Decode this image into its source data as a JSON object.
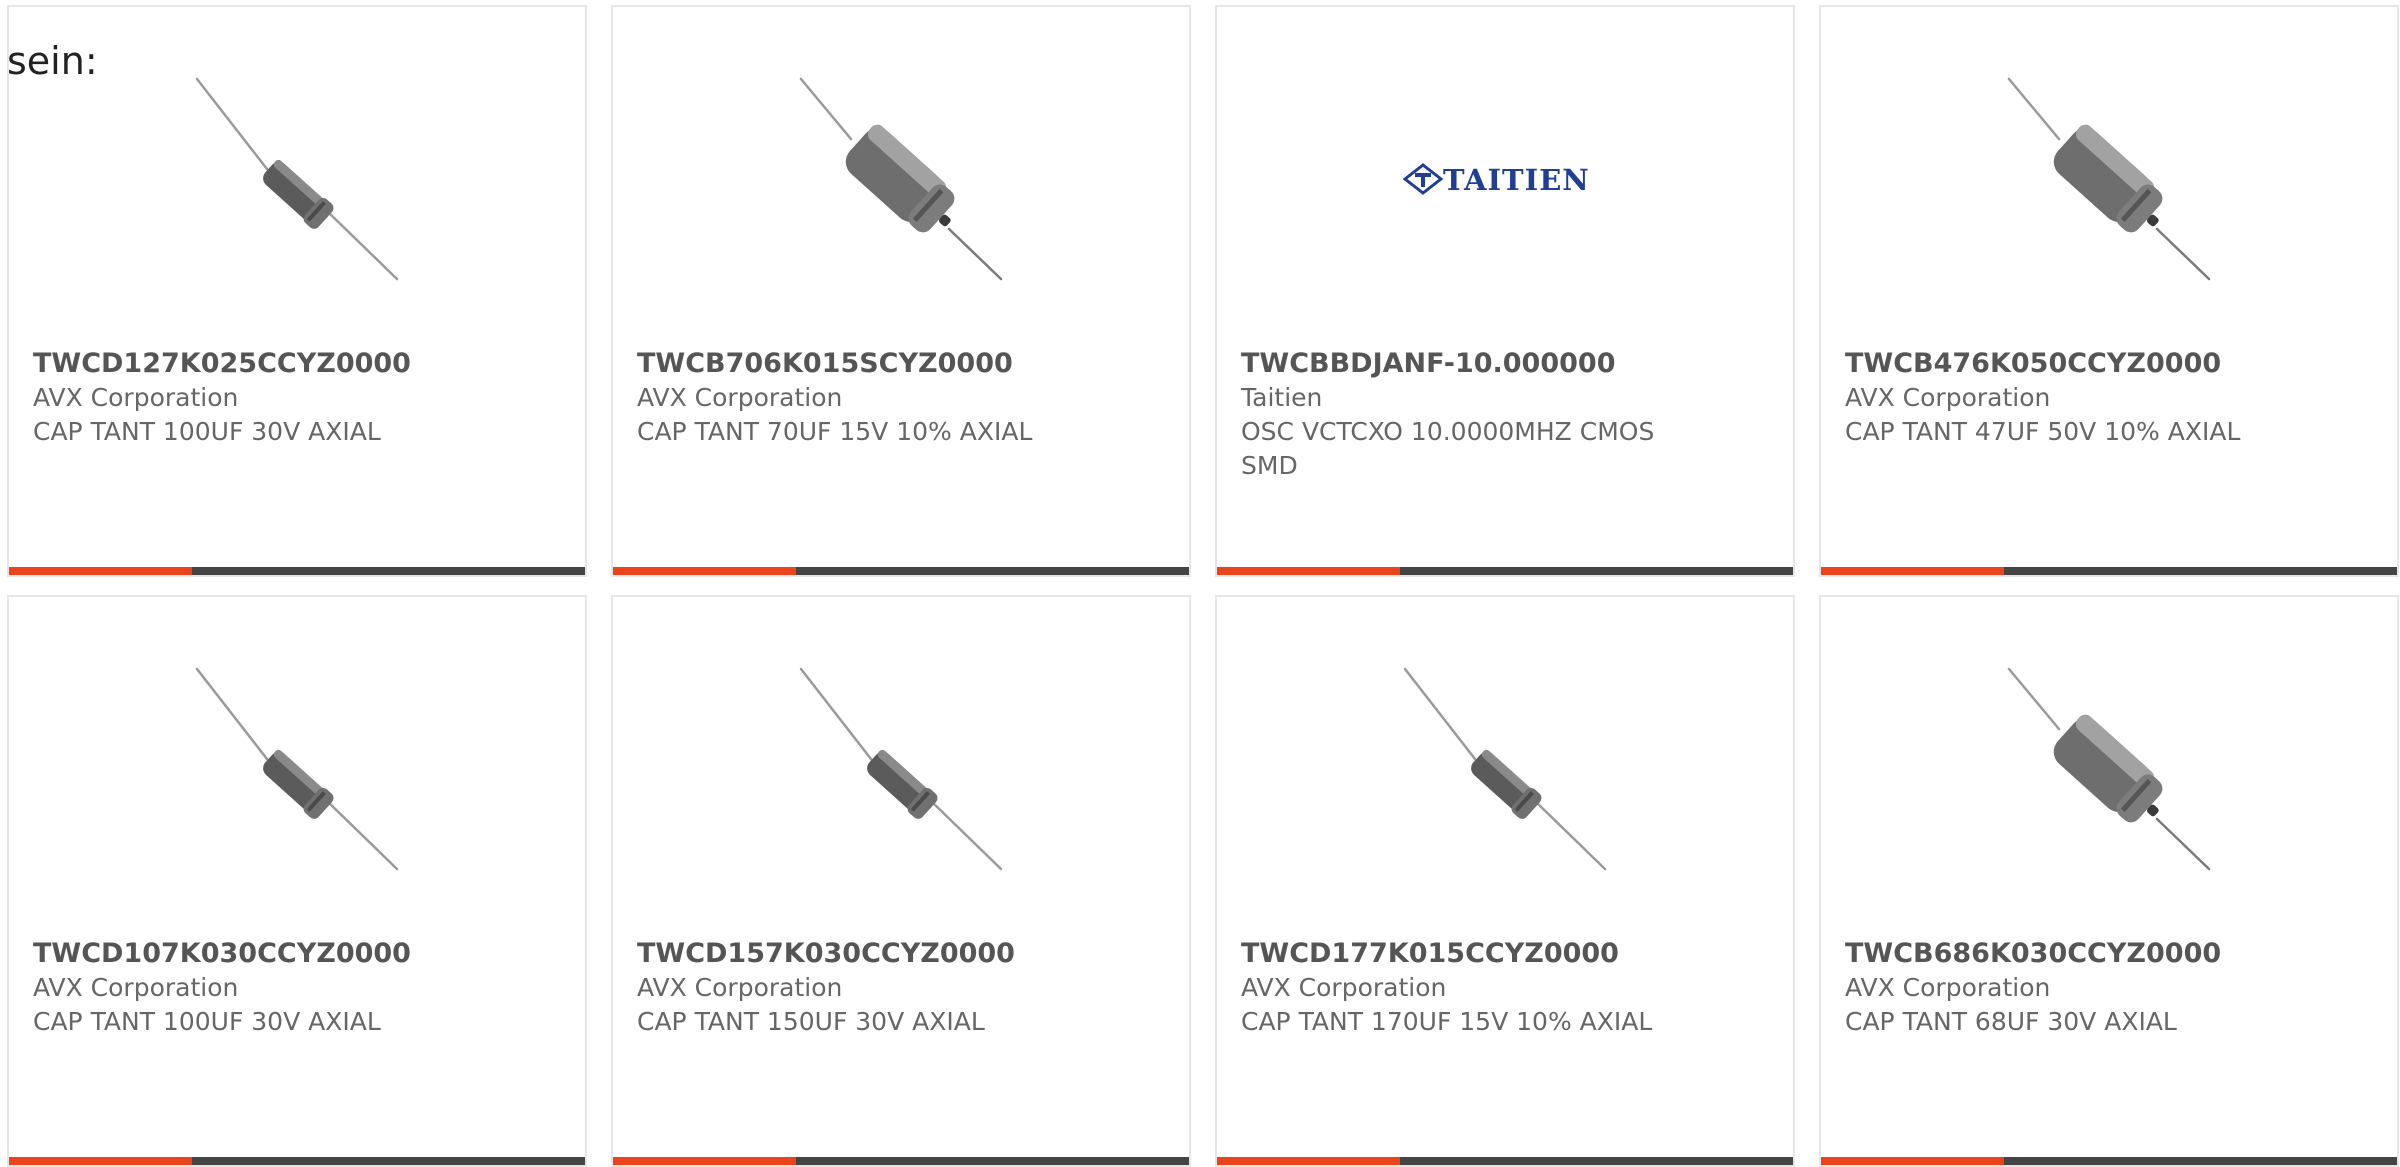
{
  "intro_text": "sein:",
  "colors": {
    "accent": "#e8451e",
    "bar": "#444444",
    "border": "#e6e6e6",
    "logo_blue": "#1f3f94"
  },
  "products": [
    {
      "part_number": "TWCD127K025CCYZ0000",
      "manufacturer": "AVX Corporation",
      "description": "CAP TANT 100UF 30V AXIAL",
      "image": "capacitor-slim"
    },
    {
      "part_number": "TWCB706K015SCYZ0000",
      "manufacturer": "AVX Corporation",
      "description": "CAP TANT 70UF 15V 10% AXIAL",
      "image": "capacitor-wide"
    },
    {
      "part_number": "TWCBBDJANF-10.000000",
      "manufacturer": "Taitien",
      "description": "OSC VCTCXO 10.0000MHZ CMOS SMD",
      "image": "taitien-logo",
      "logo_text": "TAITIEN"
    },
    {
      "part_number": "TWCB476K050CCYZ0000",
      "manufacturer": "AVX Corporation",
      "description": "CAP TANT 47UF 50V 10% AXIAL",
      "image": "capacitor-wide"
    },
    {
      "part_number": "TWCD107K030CCYZ0000",
      "manufacturer": "AVX Corporation",
      "description": "CAP TANT 100UF 30V AXIAL",
      "image": "capacitor-slim"
    },
    {
      "part_number": "TWCD157K030CCYZ0000",
      "manufacturer": "AVX Corporation",
      "description": "CAP TANT 150UF 30V AXIAL",
      "image": "capacitor-slim"
    },
    {
      "part_number": "TWCD177K015CCYZ0000",
      "manufacturer": "AVX Corporation",
      "description": "CAP TANT 170UF 15V 10% AXIAL",
      "image": "capacitor-slim"
    },
    {
      "part_number": "TWCB686K030CCYZ0000",
      "manufacturer": "AVX Corporation",
      "description": "CAP TANT 68UF 30V AXIAL",
      "image": "capacitor-wide"
    }
  ]
}
